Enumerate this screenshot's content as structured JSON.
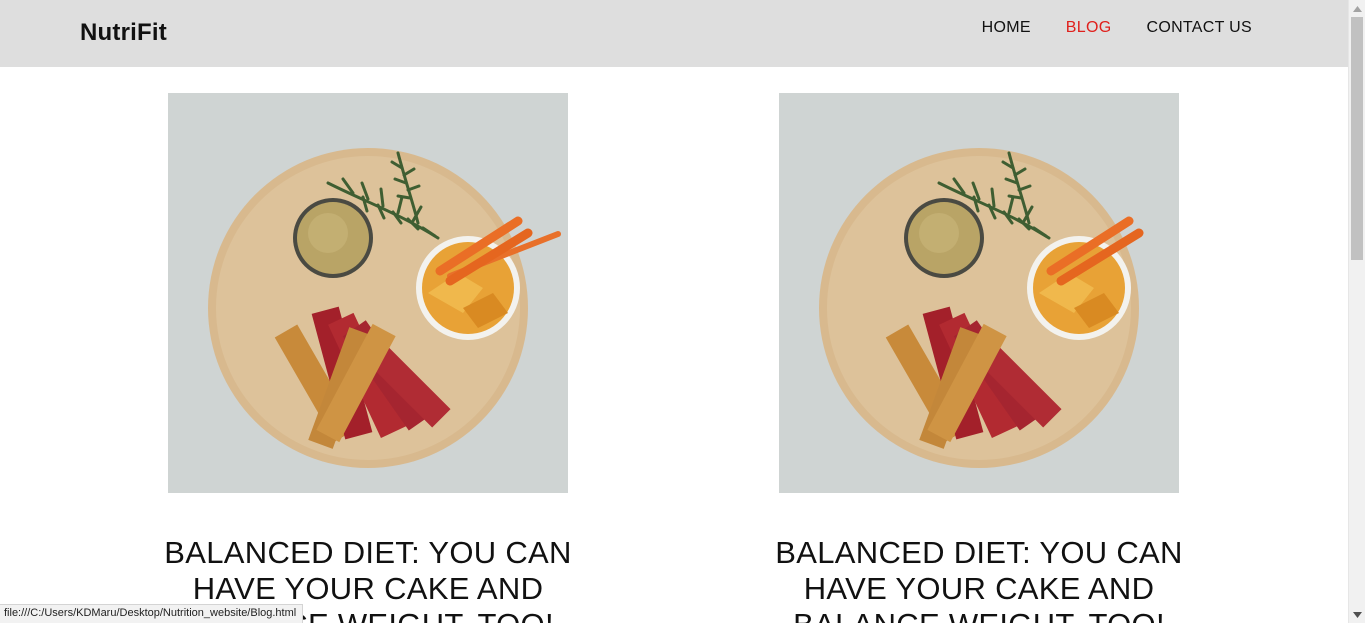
{
  "site": {
    "brand": "NutriFit",
    "nav": [
      {
        "label": "HOME",
        "active": false
      },
      {
        "label": "BLOG",
        "active": true
      },
      {
        "label": "CONTACT US",
        "active": false
      }
    ],
    "accent_color": "#e0201c"
  },
  "posts": [
    {
      "title": "BALANCED DIET: YOU CAN HAVE YOUR CAKE AND BALANCE WEIGHT, TOO!",
      "image": "food-platter-image"
    },
    {
      "title": "BALANCED DIET: YOU CAN HAVE YOUR CAKE AND BALANCE WEIGHT, TOO!",
      "image": "food-platter-image"
    }
  ],
  "status_bar": {
    "url": "file:///C:/Users/KDMaru/Desktop/Nutrition_website/Blog.html"
  }
}
